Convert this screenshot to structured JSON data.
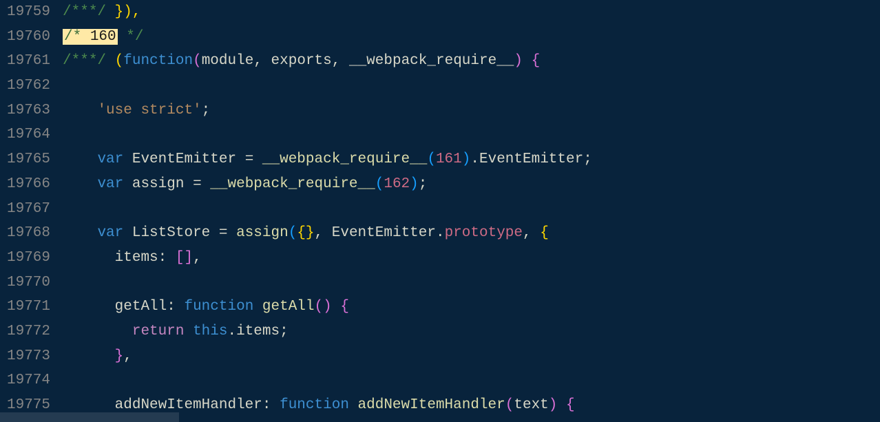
{
  "lineNumbers": [
    "19759",
    "19760",
    "19761",
    "19762",
    "19763",
    "19764",
    "19765",
    "19766",
    "19767",
    "19768",
    "19769",
    "19770",
    "19771",
    "19772",
    "19773",
    "19774",
    "19775"
  ],
  "tokens": {
    "l0_c0": "/***/",
    "l0_p0": " }),",
    "l1_hl_c": "/* ",
    "l1_hl_n": "160",
    "l1_c1": " */",
    "l2_c0": "/***/",
    "l2_p0": " (",
    "l2_k0": "function",
    "l2_p1": "(",
    "l2_i0": "module",
    "l2_p2": ", ",
    "l2_i1": "exports",
    "l2_p3": ", ",
    "l2_i2": "__webpack_require__",
    "l2_p4": ")",
    "l2_p5": " {",
    "l4_s0": "'use strict'",
    "l4_p0": ";",
    "l6_k0": "var",
    "l6_i0": " EventEmitter ",
    "l6_p0": "=",
    "l6_f0": " __webpack_require__",
    "l6_p1": "(",
    "l6_n0": "161",
    "l6_p2": ")",
    "l6_p3": ".",
    "l6_i1": "EventEmitter",
    "l6_p4": ";",
    "l7_k0": "var",
    "l7_i0": " assign ",
    "l7_p0": "=",
    "l7_f0": " __webpack_require__",
    "l7_p1": "(",
    "l7_n0": "162",
    "l7_p2": ")",
    "l7_p3": ";",
    "l9_k0": "var",
    "l9_i0": " ListStore ",
    "l9_p0": "=",
    "l9_f0": " assign",
    "l9_p1": "(",
    "l9_p2": "{}",
    "l9_p3": ", ",
    "l9_i1": "EventEmitter",
    "l9_p4": ".",
    "l9_pr0": "prototype",
    "l9_p5": ", ",
    "l9_p6": "{",
    "l10_i0": "items",
    "l10_p0": ":",
    "l10_p1": " [",
    "l10_p2": "]",
    "l10_p3": ",",
    "l12_i0": "getAll",
    "l12_p0": ":",
    "l12_k0": " function",
    "l12_f0": " getAll",
    "l12_p1": "(",
    "l12_p2": ")",
    "l12_p3": " {",
    "l13_k0": "return",
    "l13_k1": " this",
    "l13_p0": ".",
    "l13_i0": "items",
    "l13_p1": ";",
    "l14_p0": "}",
    "l14_p1": ",",
    "l16_i0": "addNewItemHandler",
    "l16_p0": ":",
    "l16_k0": " function",
    "l16_f0": " addNewItemHandler",
    "l16_p1": "(",
    "l16_i1": "text",
    "l16_p2": ")",
    "l16_p3": " {"
  },
  "indent": {
    "i1": "    ",
    "i2": "      ",
    "i3": "        "
  }
}
